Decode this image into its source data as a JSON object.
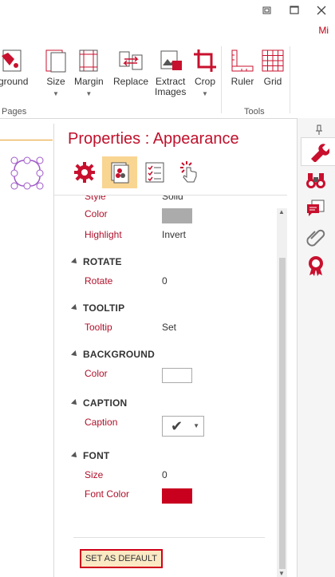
{
  "window": {
    "restore_icon": "restore-icon",
    "maximize_icon": "maximize-icon",
    "close_icon": "close-icon",
    "user_short": "Mi"
  },
  "ribbon": {
    "buttons": [
      {
        "label": "kground",
        "icon": "background-icon",
        "caret": false
      },
      {
        "label": "Size",
        "icon": "size-icon",
        "caret": true
      },
      {
        "label": "Margin",
        "icon": "margin-icon",
        "caret": true
      },
      {
        "label": "Replace",
        "icon": "replace-icon",
        "caret": false
      },
      {
        "label": "Extract\nImages",
        "icon": "extract-images-icon",
        "caret": false
      },
      {
        "label": "Crop",
        "icon": "crop-icon",
        "caret": true
      },
      {
        "label": "Ruler",
        "icon": "ruler-icon",
        "caret": false
      },
      {
        "label": "Grid",
        "icon": "grid-icon",
        "caret": false
      }
    ],
    "groups": {
      "pages": "Pages",
      "tools": "Tools"
    }
  },
  "properties": {
    "title": "Properties : Appearance",
    "tabs": [
      "settings-tab",
      "appearance-tab",
      "checklist-tab",
      "actions-tab"
    ],
    "rows": {
      "style": {
        "label": "Style",
        "value": "Solid"
      },
      "color": {
        "label": "Color"
      },
      "highlight": {
        "label": "Highlight",
        "value": "Invert"
      },
      "rotate": {
        "label": "Rotate",
        "value": "0"
      },
      "tooltip": {
        "label": "Tooltip",
        "value": "Set"
      },
      "bg_color": {
        "label": "Color"
      },
      "caption": {
        "label": "Caption"
      },
      "size": {
        "label": "Size",
        "value": "0"
      },
      "font_color": {
        "label": "Font Color"
      }
    },
    "sections": {
      "rotate": "ROTATE",
      "tooltip": "TOOLTIP",
      "background": "BACKGROUND",
      "caption": "CAPTION",
      "font": "FONT"
    },
    "swatches": {
      "color": "#ababab",
      "background": "#ffffff",
      "font_color": "#c8001e"
    },
    "set_default_label": "SET AS DEFAULT"
  },
  "sidebar": {
    "pin_icon": "pin-icon",
    "items": [
      "properties-wrench-icon",
      "binoculars-icon",
      "comments-icon",
      "attachment-icon",
      "certificate-icon"
    ]
  },
  "colors": {
    "accent": "#c0102b",
    "tab_active": "#f9d592"
  }
}
